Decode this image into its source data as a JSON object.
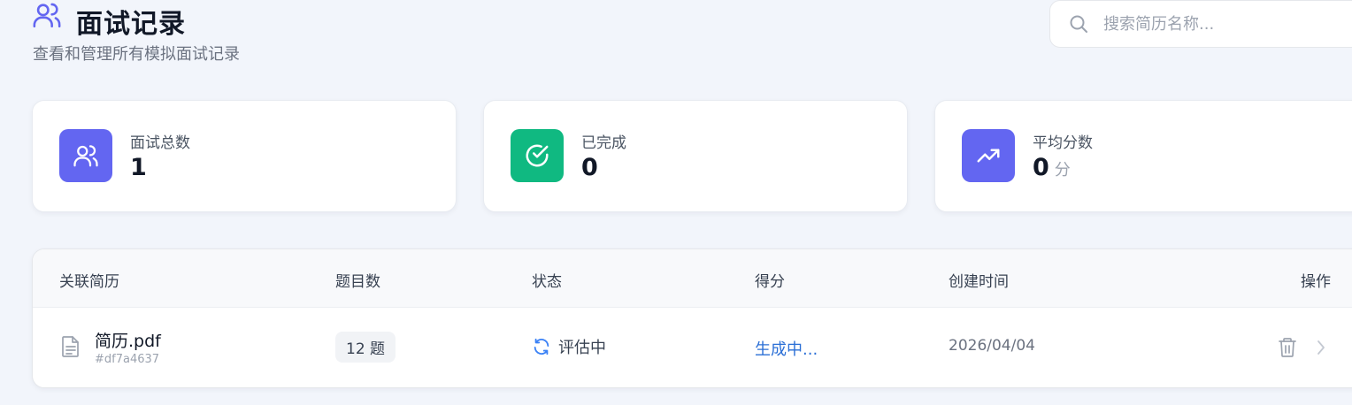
{
  "header": {
    "title": "面试记录",
    "subtitle": "查看和管理所有模拟面试记录",
    "search_placeholder": "搜索简历名称..."
  },
  "stats": [
    {
      "label": "面试总数",
      "value": "1",
      "unit": "",
      "icon": "users-icon",
      "color": "#6366f1"
    },
    {
      "label": "已完成",
      "value": "0",
      "unit": "",
      "icon": "check-circle-icon",
      "color": "#10b981"
    },
    {
      "label": "平均分数",
      "value": "0",
      "unit": "分",
      "icon": "trending-up-icon",
      "color": "#6366f1"
    }
  ],
  "table": {
    "columns": [
      "关联简历",
      "题目数",
      "状态",
      "得分",
      "创建时间",
      "操作"
    ],
    "rows": [
      {
        "file_name": "简历.pdf",
        "file_id": "#df7a4637",
        "questions": "12 题",
        "status": "评估中",
        "score": "生成中...",
        "created": "2026/04/04"
      }
    ]
  },
  "colors": {
    "accent": "#6366f1",
    "success": "#10b981",
    "link": "#2b6fd6",
    "background": "#f2f5fb"
  }
}
